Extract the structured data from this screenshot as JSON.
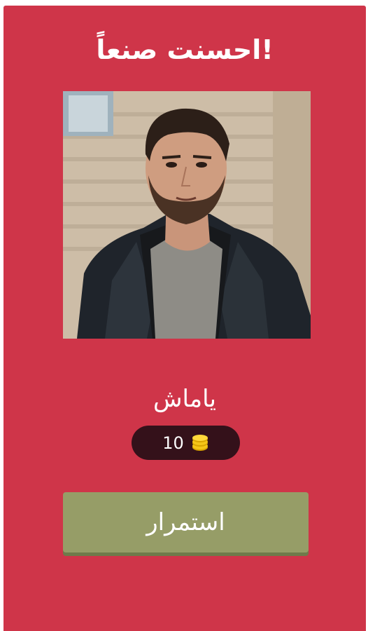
{
  "dialog": {
    "title": "!احسنت صنعاً",
    "answer": "ياماش",
    "reward": {
      "amount": "10",
      "icon": "coins-icon"
    },
    "continue_label": "استمرار"
  },
  "colors": {
    "background": "#cf3549",
    "reward_pill": "#34111a",
    "button": "#969d67",
    "coin": "#f5c518"
  },
  "image": {
    "icon": "character-portrait"
  }
}
